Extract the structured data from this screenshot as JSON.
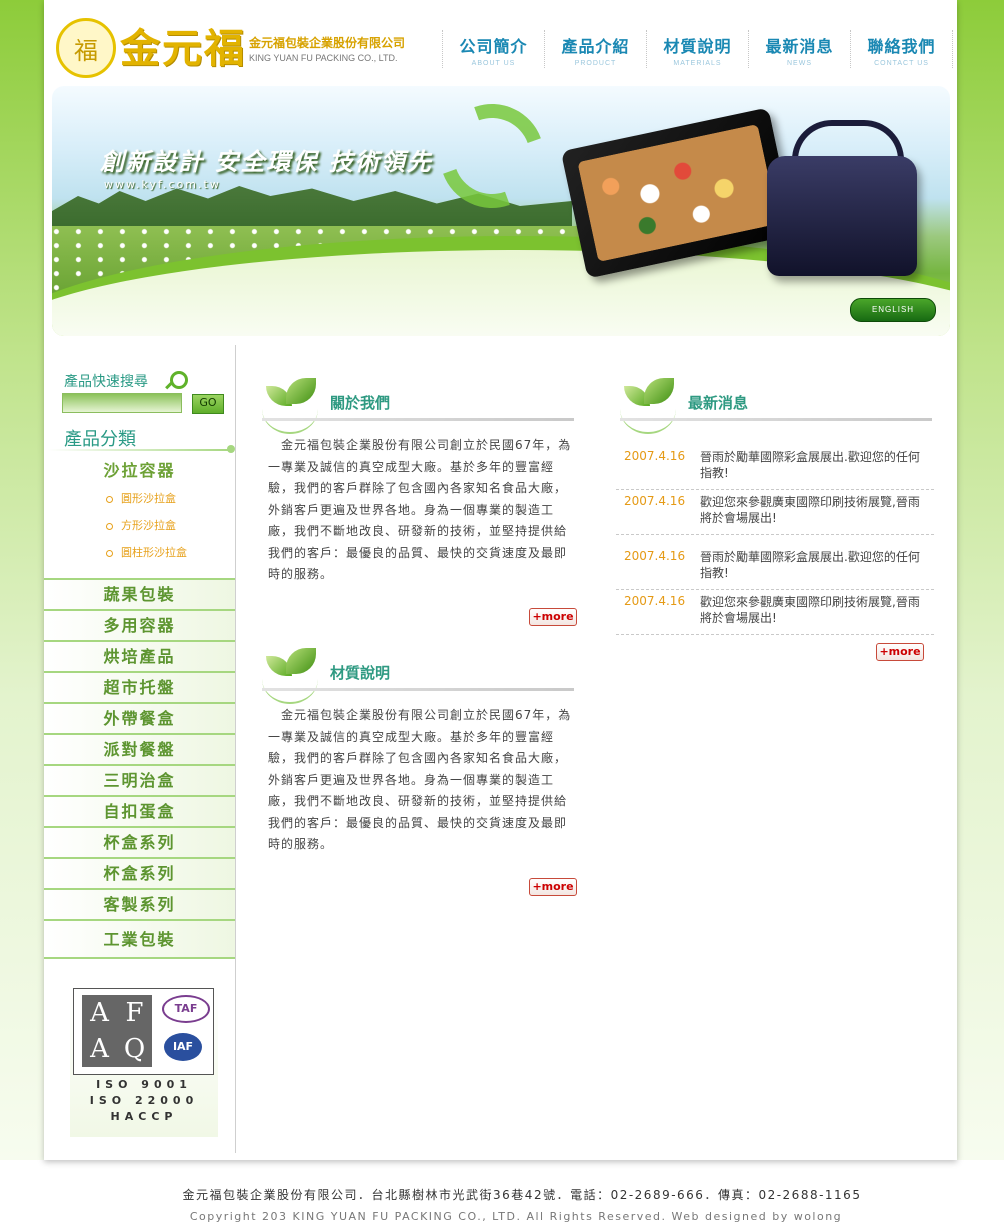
{
  "header": {
    "logo_text": "金元福",
    "company_cn": "金元福包裝企業股份有限公司",
    "company_en": "KING YUAN FU PACKING CO., LTD."
  },
  "nav": [
    {
      "label": "公司簡介",
      "sub": "ABOUT US"
    },
    {
      "label": "產品介紹",
      "sub": "PRODUCT"
    },
    {
      "label": "材質說明",
      "sub": "MATERIALS"
    },
    {
      "label": "最新消息",
      "sub": "NEWS"
    },
    {
      "label": "聯絡我們",
      "sub": "CONTACT US"
    }
  ],
  "banner": {
    "slogan": "創新設計  安全環保  技術領先",
    "url": "www.kyf.com.tw",
    "english_button": "ENGLISH"
  },
  "sidebar": {
    "search_title": "產品快速搜尋",
    "search_value": "",
    "go_label": "GO",
    "category_title": "產品分類",
    "active_category": "沙拉容器",
    "sub_items": [
      "圓形沙拉盒",
      "方形沙拉盒",
      "圓柱形沙拉盒"
    ],
    "categories": [
      "蔬果包裝",
      "多用容器",
      "烘培產品",
      "超市托盤",
      "外帶餐盒",
      "派對餐盤",
      "三明治盒",
      "自扣蛋盒",
      "杯盒系列",
      "杯盒系列",
      "客製系列",
      "工業包裝"
    ],
    "cert_lines": [
      "ISO 9001",
      "ISO 22000",
      "HACCP"
    ],
    "cert_logo": {
      "afaq": [
        "A",
        "F",
        "A",
        "Q"
      ],
      "taf": "TAF",
      "iaf": "IAF"
    }
  },
  "main": {
    "about": {
      "title": "關於我們",
      "text": "　金元福包裝企業股份有限公司創立於民國67年，為一專業及誠信的真空成型大廠。基於多年的豐富經驗，我們的客戶群除了包含國內各家知名食品大廠，外銷客戶更遍及世界各地。身為一個專業的製造工廠，我們不斷地改良、研發新的技術，並堅持提供給我們的客戶：最優良的品質、最快的交貨速度及最即時的服務。",
      "more": "+more"
    },
    "material": {
      "title": "材質說明",
      "text": "　金元福包裝企業股份有限公司創立於民國67年，為一專業及誠信的真空成型大廠。基於多年的豐富經驗，我們的客戶群除了包含國內各家知名食品大廠，外銷客戶更遍及世界各地。身為一個專業的製造工廠，我們不斷地改良、研發新的技術，並堅持提供給我們的客戶：最優良的品質、最快的交貨速度及最即時的服務。",
      "more": "+more"
    },
    "news": {
      "title": "最新消息",
      "more": "+more",
      "items": [
        {
          "date": "2007.4.16",
          "text": "晉雨於勵華國際彩盒展展出.歡迎您的任何指教!"
        },
        {
          "date": "2007.4.16",
          "text": "歡迎您來參觀廣東國際印刷技術展覽,晉雨將於會場展出!"
        },
        {
          "date": "2007.4.16",
          "text": "晉雨於勵華國際彩盒展展出.歡迎您的任何指教!"
        },
        {
          "date": "2007.4.16",
          "text": "歡迎您來參觀廣東國際印刷技術展覽,晉雨將於會場展出!"
        }
      ]
    }
  },
  "footer": {
    "line1": "金元福包裝企業股份有限公司．台北縣樹林市光武街36巷42號．電話：02-2689-666．傳真：02-2688-1165",
    "line2": "Copyright 203 KING YUAN FU PACKING CO., LTD. All Rights Reserved. Web designed by wolong"
  }
}
